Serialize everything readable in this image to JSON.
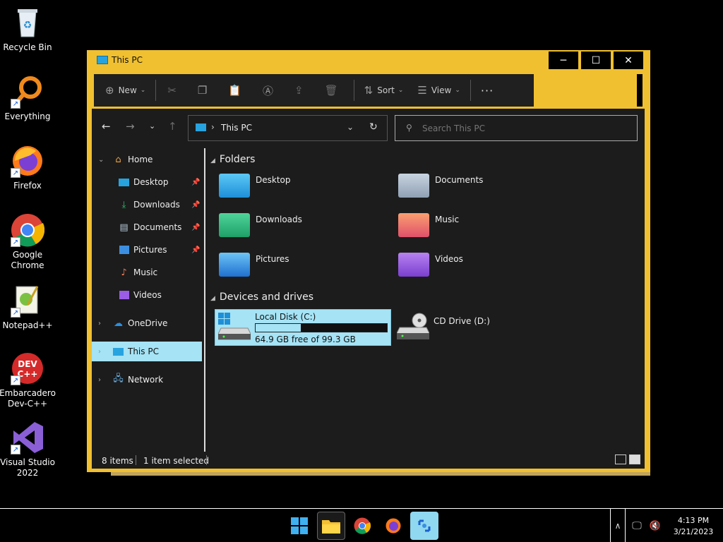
{
  "desktop": {
    "icons": [
      {
        "label": "Recycle Bin"
      },
      {
        "label": "Everything"
      },
      {
        "label": "Firefox"
      },
      {
        "label": "Google Chrome"
      },
      {
        "label": "Notepad++"
      },
      {
        "label": "Embarcadero Dev-C++"
      },
      {
        "label": "Visual Studio 2022"
      }
    ]
  },
  "window": {
    "title": "This PC",
    "buttons": {
      "minimize": "─",
      "maximize": "☐",
      "close": "✕"
    }
  },
  "commandbar": {
    "new_label": "New",
    "sort_label": "Sort",
    "view_label": "View",
    "more_label": "···"
  },
  "address": {
    "path": "This PC",
    "search_placeholder": "Search This PC"
  },
  "sidebar": {
    "items": [
      {
        "label": "Home"
      },
      {
        "label": "Desktop"
      },
      {
        "label": "Downloads"
      },
      {
        "label": "Documents"
      },
      {
        "label": "Pictures"
      },
      {
        "label": "Music"
      },
      {
        "label": "Videos"
      },
      {
        "label": "OneDrive"
      },
      {
        "label": "This PC"
      },
      {
        "label": "Network"
      }
    ]
  },
  "main": {
    "folders_header": "Folders",
    "folders": [
      {
        "label": "Desktop"
      },
      {
        "label": "Documents"
      },
      {
        "label": "Downloads"
      },
      {
        "label": "Music"
      },
      {
        "label": "Pictures"
      },
      {
        "label": "Videos"
      }
    ],
    "drives_header": "Devices and drives",
    "drives": [
      {
        "label": "Local Disk (C:)",
        "free_text": "64.9 GB free of 99.3 GB",
        "used_fraction": 0.346
      },
      {
        "label": "CD Drive (D:)"
      }
    ]
  },
  "status": {
    "items_count": "8 items",
    "selected": "1 item selected"
  },
  "taskbar": {
    "time": "4:13 PM",
    "date": "3/21/2023"
  },
  "colors": {
    "accent_yellow": "#f0c030",
    "selection_cyan": "#a5e3f5"
  }
}
